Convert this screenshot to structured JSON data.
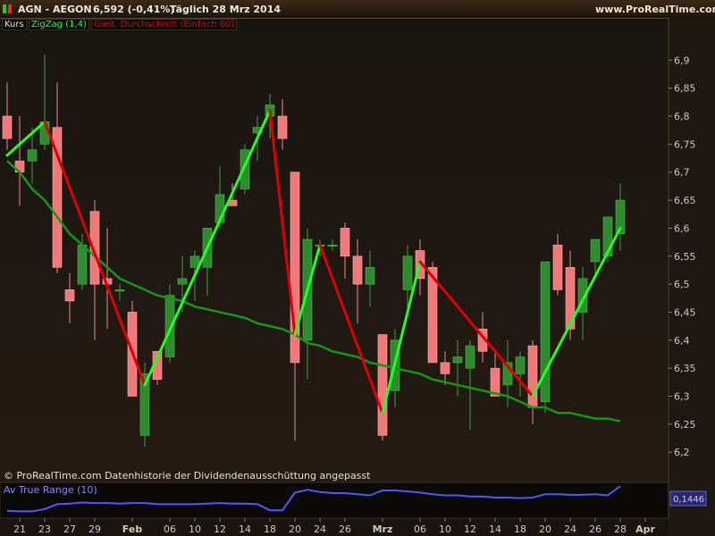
{
  "header": {
    "symbol": "AGN - AEGON",
    "quote": "6,592 (-0,41%)",
    "period": "Täglich  28 Mrz 2014",
    "site": "www.ProRealTime.com"
  },
  "legend": {
    "price": "Kurs",
    "zigzag": "ZigZag (1,4)",
    "sma": "Gleit. Durchschnitt (Einfach 60)"
  },
  "footer_note": "© ProRealTime.com  Datenhistorie der Dividendenausschüttung angepasst",
  "atr": {
    "label": "Av True Range (10)",
    "last_value": "0,1446"
  },
  "last_price_label": "6,5",
  "colors": {
    "bull": "#2e8b2e",
    "bear": "#f07878",
    "zigzag_up": "#22ff22",
    "zigzag_down": "#dd0000",
    "sma": "#119911",
    "atr": "#5555ff"
  },
  "chart_data": {
    "type": "candlestick",
    "ylim": [
      6.17,
      6.95
    ],
    "yticks": [
      "6,9",
      "6,85",
      "6,8",
      "6,75",
      "6,7",
      "6,65",
      "6,6",
      "6,55",
      "6,5",
      "6,45",
      "6,4",
      "6,35",
      "6,3",
      "6,25",
      "6,2"
    ],
    "yticks_values": [
      6.9,
      6.85,
      6.8,
      6.75,
      6.7,
      6.65,
      6.6,
      6.55,
      6.5,
      6.45,
      6.4,
      6.35,
      6.3,
      6.25,
      6.2
    ],
    "xticks": [
      {
        "label": "21",
        "i": 1
      },
      {
        "label": "23",
        "i": 3
      },
      {
        "label": "27",
        "i": 5
      },
      {
        "label": "29",
        "i": 7
      },
      {
        "label": "Feb",
        "i": 10
      },
      {
        "label": "06",
        "i": 13
      },
      {
        "label": "10",
        "i": 15
      },
      {
        "label": "12",
        "i": 17
      },
      {
        "label": "14",
        "i": 19
      },
      {
        "label": "18",
        "i": 21
      },
      {
        "label": "20",
        "i": 23
      },
      {
        "label": "24",
        "i": 25
      },
      {
        "label": "26",
        "i": 27
      },
      {
        "label": "Mrz",
        "i": 30
      },
      {
        "label": "06",
        "i": 33
      },
      {
        "label": "10",
        "i": 35
      },
      {
        "label": "12",
        "i": 37
      },
      {
        "label": "14",
        "i": 39
      },
      {
        "label": "18",
        "i": 41
      },
      {
        "label": "20",
        "i": 43
      },
      {
        "label": "24",
        "i": 45
      },
      {
        "label": "26",
        "i": 47
      },
      {
        "label": "28",
        "i": 49
      },
      {
        "label": "Apr",
        "i": 51
      }
    ],
    "candles": [
      {
        "o": 6.8,
        "h": 6.86,
        "l": 6.74,
        "c": 6.76
      },
      {
        "o": 6.72,
        "h": 6.8,
        "l": 6.64,
        "c": 6.7
      },
      {
        "o": 6.72,
        "h": 6.78,
        "l": 6.68,
        "c": 6.74
      },
      {
        "o": 6.75,
        "h": 6.91,
        "l": 6.74,
        "c": 6.79
      },
      {
        "o": 6.78,
        "h": 6.86,
        "l": 6.52,
        "c": 6.53
      },
      {
        "o": 6.49,
        "h": 6.52,
        "l": 6.43,
        "c": 6.47
      },
      {
        "o": 6.5,
        "h": 6.59,
        "l": 6.49,
        "c": 6.57
      },
      {
        "o": 6.63,
        "h": 6.65,
        "l": 6.4,
        "c": 6.5
      },
      {
        "o": 6.51,
        "h": 6.6,
        "l": 6.42,
        "c": 6.5
      },
      {
        "o": 6.49,
        "h": 6.5,
        "l": 6.47,
        "c": 6.49
      },
      {
        "o": 6.45,
        "h": 6.47,
        "l": 6.31,
        "c": 6.3
      },
      {
        "o": 6.23,
        "h": 6.36,
        "l": 6.21,
        "c": 6.34
      },
      {
        "o": 6.38,
        "h": 6.38,
        "l": 6.32,
        "c": 6.33
      },
      {
        "o": 6.37,
        "h": 6.5,
        "l": 6.36,
        "c": 6.48
      },
      {
        "o": 6.5,
        "h": 6.55,
        "l": 6.45,
        "c": 6.51
      },
      {
        "o": 6.53,
        "h": 6.56,
        "l": 6.47,
        "c": 6.55
      },
      {
        "o": 6.53,
        "h": 6.6,
        "l": 6.48,
        "c": 6.6
      },
      {
        "o": 6.61,
        "h": 6.71,
        "l": 6.6,
        "c": 6.66
      },
      {
        "o": 6.65,
        "h": 6.68,
        "l": 6.64,
        "c": 6.64
      },
      {
        "o": 6.67,
        "h": 6.75,
        "l": 6.66,
        "c": 6.74
      },
      {
        "o": 6.77,
        "h": 6.8,
        "l": 6.72,
        "c": 6.78
      },
      {
        "o": 6.8,
        "h": 6.84,
        "l": 6.76,
        "c": 6.82
      },
      {
        "o": 6.8,
        "h": 6.83,
        "l": 6.74,
        "c": 6.76
      },
      {
        "o": 6.7,
        "h": 6.7,
        "l": 6.22,
        "c": 6.36
      },
      {
        "o": 6.4,
        "h": 6.6,
        "l": 6.33,
        "c": 6.58
      },
      {
        "o": 6.57,
        "h": 6.58,
        "l": 6.55,
        "c": 6.57
      },
      {
        "o": 6.57,
        "h": 6.58,
        "l": 6.56,
        "c": 6.57
      },
      {
        "o": 6.6,
        "h": 6.61,
        "l": 6.51,
        "c": 6.55
      },
      {
        "o": 6.55,
        "h": 6.58,
        "l": 6.43,
        "c": 6.5
      },
      {
        "o": 6.5,
        "h": 6.56,
        "l": 6.46,
        "c": 6.53
      },
      {
        "o": 6.41,
        "h": 6.41,
        "l": 6.22,
        "c": 6.23
      },
      {
        "o": 6.31,
        "h": 6.42,
        "l": 6.28,
        "c": 6.4
      },
      {
        "o": 6.49,
        "h": 6.57,
        "l": 6.46,
        "c": 6.55
      },
      {
        "o": 6.56,
        "h": 6.58,
        "l": 6.48,
        "c": 6.51
      },
      {
        "o": 6.53,
        "h": 6.54,
        "l": 6.36,
        "c": 6.36
      },
      {
        "o": 6.36,
        "h": 6.38,
        "l": 6.32,
        "c": 6.34
      },
      {
        "o": 6.36,
        "h": 6.4,
        "l": 6.3,
        "c": 6.37
      },
      {
        "o": 6.35,
        "h": 6.4,
        "l": 6.24,
        "c": 6.39
      },
      {
        "o": 6.42,
        "h": 6.45,
        "l": 6.36,
        "c": 6.38
      },
      {
        "o": 6.35,
        "h": 6.38,
        "l": 6.3,
        "c": 6.3
      },
      {
        "o": 6.32,
        "h": 6.4,
        "l": 6.28,
        "c": 6.36
      },
      {
        "o": 6.34,
        "h": 6.38,
        "l": 6.3,
        "c": 6.37
      },
      {
        "o": 6.39,
        "h": 6.4,
        "l": 6.25,
        "c": 6.28
      },
      {
        "o": 6.29,
        "h": 6.54,
        "l": 6.27,
        "c": 6.54
      },
      {
        "o": 6.57,
        "h": 6.59,
        "l": 6.48,
        "c": 6.49
      },
      {
        "o": 6.53,
        "h": 6.56,
        "l": 6.4,
        "c": 6.42
      },
      {
        "o": 6.45,
        "h": 6.53,
        "l": 6.4,
        "c": 6.51
      },
      {
        "o": 6.54,
        "h": 6.58,
        "l": 6.52,
        "c": 6.58
      },
      {
        "o": 6.55,
        "h": 6.62,
        "l": 6.54,
        "c": 6.62
      },
      {
        "o": 6.59,
        "h": 6.68,
        "l": 6.56,
        "c": 6.65
      }
    ],
    "sma": [
      6.72,
      6.7,
      6.67,
      6.65,
      6.62,
      6.59,
      6.57,
      6.55,
      6.53,
      6.51,
      6.5,
      6.49,
      6.48,
      6.475,
      6.47,
      6.46,
      6.455,
      6.45,
      6.445,
      6.44,
      6.43,
      6.425,
      6.42,
      6.41,
      6.395,
      6.39,
      6.38,
      6.375,
      6.37,
      6.36,
      6.355,
      6.35,
      6.345,
      6.34,
      6.33,
      6.325,
      6.32,
      6.315,
      6.31,
      6.305,
      6.3,
      6.29,
      6.28,
      6.28,
      6.27,
      6.27,
      6.265,
      6.26,
      6.26,
      6.255
    ],
    "zigzag": [
      {
        "i": 0,
        "v": 6.73
      },
      {
        "i": 3,
        "v": 6.79
      },
      {
        "i": 11,
        "v": 6.32
      },
      {
        "i": 21,
        "v": 6.81
      },
      {
        "i": 23,
        "v": 6.41
      },
      {
        "i": 25,
        "v": 6.57
      },
      {
        "i": 30,
        "v": 6.27
      },
      {
        "i": 33,
        "v": 6.54
      },
      {
        "i": 42,
        "v": 6.3
      },
      {
        "i": 49,
        "v": 6.6
      }
    ],
    "atr": [
      0.1,
      0.099,
      0.099,
      0.103,
      0.112,
      0.113,
      0.115,
      0.114,
      0.114,
      0.113,
      0.114,
      0.114,
      0.112,
      0.112,
      0.112,
      0.112,
      0.113,
      0.114,
      0.113,
      0.113,
      0.112,
      0.101,
      0.101,
      0.133,
      0.138,
      0.134,
      0.132,
      0.132,
      0.13,
      0.128,
      0.137,
      0.137,
      0.135,
      0.133,
      0.13,
      0.128,
      0.128,
      0.126,
      0.126,
      0.124,
      0.124,
      0.123,
      0.124,
      0.13,
      0.13,
      0.129,
      0.129,
      0.13,
      0.128,
      0.1446
    ],
    "atr_ylim": [
      0.09,
      0.145
    ]
  }
}
